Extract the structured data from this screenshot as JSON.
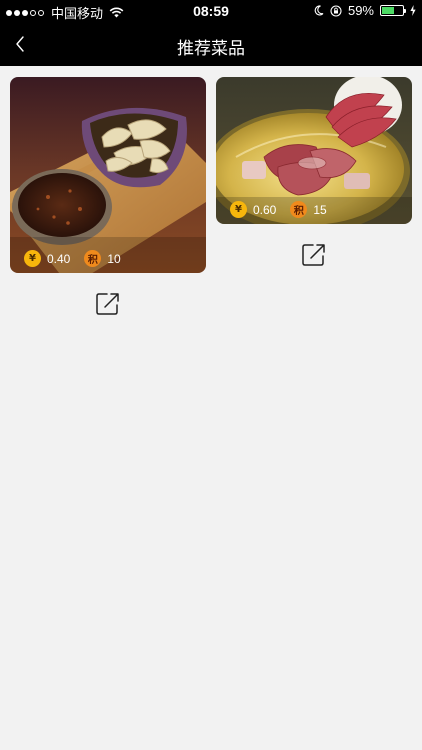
{
  "status_bar": {
    "carrier": "中国移动",
    "time": "08:59",
    "battery_percent": "59%",
    "battery_level": 0.59,
    "signal_bars_filled": 3,
    "signal_bars_total": 5,
    "icons": [
      "wifi-icon",
      "moon-icon",
      "orientation-lock-icon",
      "battery-icon",
      "charging-bolt-icon"
    ]
  },
  "nav": {
    "title": "推荐菜品",
    "back_icon": "chevron-left-icon"
  },
  "dishes": [
    {
      "image": "photo of mushrooms in a bowl with a dish of dark sauce on a wooden board",
      "price_badge": "¥",
      "price": "0.40",
      "points_badge": "积",
      "points": "10",
      "share_icon": "share-icon"
    },
    {
      "image": "photo of sliced raw beef on a plate over a golden hotpot",
      "price_badge": "¥",
      "price": "0.60",
      "points_badge": "积",
      "points": "15",
      "share_icon": "share-icon"
    }
  ],
  "colors": {
    "bar_background": "#000000",
    "page_background": "#f2f2f2",
    "price_badge": "#f7b60c",
    "points_badge": "#f08a1c",
    "battery_fill": "#4cd964"
  }
}
